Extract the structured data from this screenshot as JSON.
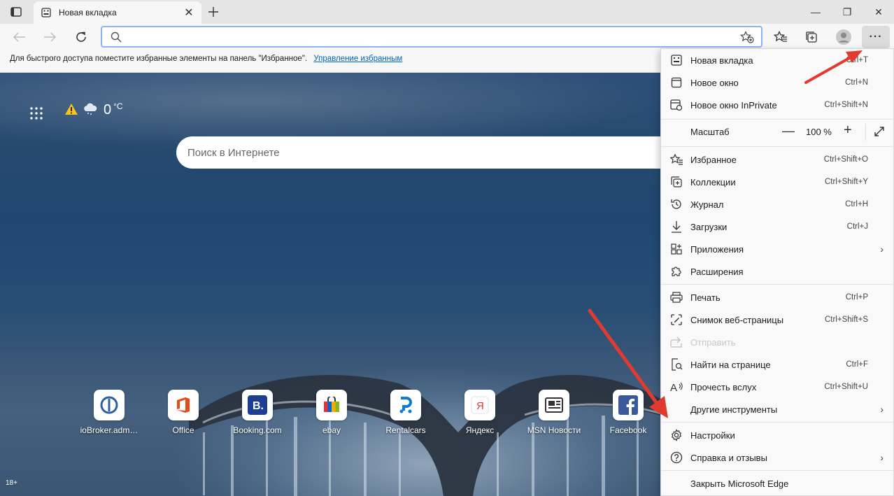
{
  "tab": {
    "title": "Новая вкладка",
    "close": "✕"
  },
  "window": {
    "minimize": "—",
    "restore": "❐",
    "close": "✕"
  },
  "address": {
    "value": "",
    "placeholder": ""
  },
  "favorites_bar": {
    "hint": "Для быстрого доступа поместите избранные элементы на панель \"Избранное\".",
    "link": "Управление избранным"
  },
  "weather": {
    "temp": "0",
    "unit": "°C"
  },
  "search": {
    "placeholder": "Поиск в Интернете"
  },
  "tiles": [
    {
      "label": "ioBroker.adm…",
      "icon": "iobroker-icon"
    },
    {
      "label": "Office",
      "icon": "office-icon"
    },
    {
      "label": "Booking.com",
      "icon": "booking-icon"
    },
    {
      "label": "ebay",
      "icon": "ebay-icon"
    },
    {
      "label": "Rentalcars",
      "icon": "rentalcars-icon"
    },
    {
      "label": "Яндекс",
      "icon": "yandex-icon"
    },
    {
      "label": "MSN Новости",
      "icon": "msn-news-icon"
    },
    {
      "label": "Facebook",
      "icon": "facebook-icon"
    }
  ],
  "age_badge": "18+",
  "menu": {
    "new_tab": {
      "label": "Новая вкладка",
      "shortcut": "Ctrl+T"
    },
    "new_window": {
      "label": "Новое окно",
      "shortcut": "Ctrl+N"
    },
    "inprivate": {
      "label": "Новое окно InPrivate",
      "shortcut": "Ctrl+Shift+N"
    },
    "zoom": {
      "label": "Масштаб",
      "minus": "—",
      "value": "100 %",
      "plus": "+"
    },
    "favorites": {
      "label": "Избранное",
      "shortcut": "Ctrl+Shift+O"
    },
    "collections": {
      "label": "Коллекции",
      "shortcut": "Ctrl+Shift+Y"
    },
    "history": {
      "label": "Журнал",
      "shortcut": "Ctrl+H"
    },
    "downloads": {
      "label": "Загрузки",
      "shortcut": "Ctrl+J"
    },
    "apps": {
      "label": "Приложения",
      "arrow": "›"
    },
    "extensions": {
      "label": "Расширения"
    },
    "print": {
      "label": "Печать",
      "shortcut": "Ctrl+P"
    },
    "screenshot": {
      "label": "Снимок веб-страницы",
      "shortcut": "Ctrl+Shift+S"
    },
    "share": {
      "label": "Отправить"
    },
    "find": {
      "label": "Найти на странице",
      "shortcut": "Ctrl+F"
    },
    "read_aloud": {
      "label": "Прочесть вслух",
      "shortcut": "Ctrl+Shift+U"
    },
    "more_tools": {
      "label": "Другие инструменты",
      "arrow": "›"
    },
    "settings": {
      "label": "Настройки"
    },
    "help": {
      "label": "Справка и отзывы",
      "arrow": "›"
    },
    "close_edge": {
      "label": "Закрыть Microsoft Edge"
    }
  },
  "colors": {
    "accent": "#8ab4f8",
    "annotation_arrow": "#e03b2e",
    "link": "#0066b4"
  }
}
